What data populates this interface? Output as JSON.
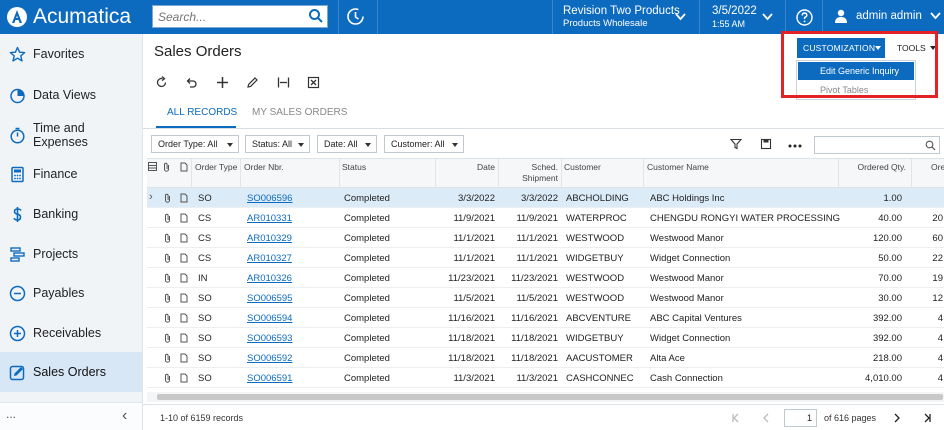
{
  "app": {
    "brand": "Acumatica"
  },
  "search": {
    "placeholder": "Search..."
  },
  "branch": {
    "company": "Revision Two Products",
    "branch": "Products Wholesale"
  },
  "datetime": {
    "date": "3/5/2022",
    "time": "1:55 AM"
  },
  "user": {
    "name": "admin admin"
  },
  "sidebar": {
    "items": [
      {
        "label": "Favorites",
        "icon": "star-icon"
      },
      {
        "label": "Data Views",
        "icon": "pie-chart-icon"
      },
      {
        "label": "Time and Expenses",
        "icon": "stopwatch-icon"
      },
      {
        "label": "Finance",
        "icon": "calculator-icon"
      },
      {
        "label": "Banking",
        "icon": "dollar-icon"
      },
      {
        "label": "Projects",
        "icon": "projects-icon"
      },
      {
        "label": "Payables",
        "icon": "minus-circle-icon"
      },
      {
        "label": "Receivables",
        "icon": "plus-circle-icon"
      },
      {
        "label": "Sales Orders",
        "icon": "edit-icon",
        "active": true
      }
    ],
    "more": "...",
    "collapse": "‹"
  },
  "page": {
    "title": "Sales Orders"
  },
  "toolbar": {
    "customization": "CUSTOMIZATION",
    "tools": "TOOLS",
    "menu": [
      "Edit Generic Inquiry",
      "Pivot Tables"
    ]
  },
  "tabs": [
    {
      "label": "ALL RECORDS",
      "active": true
    },
    {
      "label": "MY SALES ORDERS"
    }
  ],
  "filters": [
    "Order Type: All",
    "Status: All",
    "Date: All",
    "Customer: All"
  ],
  "grid": {
    "columns": [
      "Order Type",
      "Order Nbr.",
      "Status",
      "Date",
      "Sched. Shipment",
      "Customer",
      "Customer Name",
      "Ordered Qty.",
      "Ore"
    ],
    "rows": [
      {
        "type": "SO",
        "nbr": "SO006596",
        "status": "Completed",
        "date": "3/3/2022",
        "sched": "3/3/2022",
        "customer": "ABCHOLDING",
        "name": "ABC Holdings Inc",
        "qty": "1.00",
        "extra": ""
      },
      {
        "type": "CS",
        "nbr": "AR010331",
        "status": "Completed",
        "date": "11/9/2021",
        "sched": "11/9/2021",
        "customer": "WATERPROC",
        "name": "CHENGDU RONGYI WATER PROCESSING",
        "qty": "40.00",
        "extra": "20"
      },
      {
        "type": "CS",
        "nbr": "AR010329",
        "status": "Completed",
        "date": "11/1/2021",
        "sched": "11/1/2021",
        "customer": "WESTWOOD",
        "name": "Westwood Manor",
        "qty": "120.00",
        "extra": "60"
      },
      {
        "type": "CS",
        "nbr": "AR010327",
        "status": "Completed",
        "date": "11/1/2021",
        "sched": "11/1/2021",
        "customer": "WIDGETBUY",
        "name": "Widget Connection",
        "qty": "50.00",
        "extra": "22"
      },
      {
        "type": "IN",
        "nbr": "AR010326",
        "status": "Completed",
        "date": "11/23/2021",
        "sched": "11/23/2021",
        "customer": "WESTWOOD",
        "name": "Westwood Manor",
        "qty": "70.00",
        "extra": "19"
      },
      {
        "type": "SO",
        "nbr": "SO006595",
        "status": "Completed",
        "date": "11/5/2021",
        "sched": "11/5/2021",
        "customer": "WESTWOOD",
        "name": "Westwood Manor",
        "qty": "30.00",
        "extra": "12"
      },
      {
        "type": "SO",
        "nbr": "SO006594",
        "status": "Completed",
        "date": "11/16/2021",
        "sched": "11/16/2021",
        "customer": "ABCVENTURE",
        "name": "ABC Capital Ventures",
        "qty": "392.00",
        "extra": "4"
      },
      {
        "type": "SO",
        "nbr": "SO006593",
        "status": "Completed",
        "date": "11/18/2021",
        "sched": "11/18/2021",
        "customer": "WIDGETBUY",
        "name": "Widget Connection",
        "qty": "392.00",
        "extra": "4"
      },
      {
        "type": "SO",
        "nbr": "SO006592",
        "status": "Completed",
        "date": "11/18/2021",
        "sched": "11/18/2021",
        "customer": "AACUSTOMER",
        "name": "Alta Ace",
        "qty": "218.00",
        "extra": "4"
      },
      {
        "type": "SO",
        "nbr": "SO006591",
        "status": "Completed",
        "date": "11/3/2021",
        "sched": "11/3/2021",
        "customer": "CASHCONNEC",
        "name": "Cash Connection",
        "qty": "4,010.00",
        "extra": "4"
      }
    ]
  },
  "pager": {
    "records": "1-10 of 6159 records",
    "page": "1",
    "of_pages": "of 616 pages"
  },
  "colors": {
    "brand": "#0d6bbf",
    "highlight": "#e32226",
    "selected_row": "#dcebf8"
  }
}
